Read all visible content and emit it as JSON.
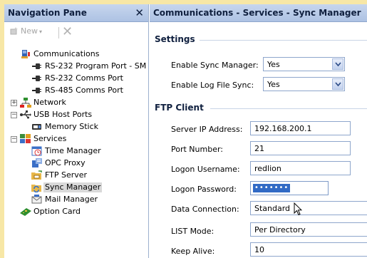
{
  "nav": {
    "title": "Navigation Pane",
    "new_label": "New",
    "tree": [
      {
        "label": "Communications",
        "icon": "communications-icon"
      },
      {
        "label": "RS-232 Program Port - SM",
        "icon": "serial-port-icon"
      },
      {
        "label": "RS-232 Comms Port",
        "icon": "serial-port-icon"
      },
      {
        "label": "RS-485 Comms Port",
        "icon": "serial-port-icon"
      },
      {
        "label": "Network",
        "icon": "network-icon"
      },
      {
        "label": "USB Host Ports",
        "icon": "usb-icon"
      },
      {
        "label": "Memory Stick",
        "icon": "memory-stick-icon"
      },
      {
        "label": "Services",
        "icon": "services-icon"
      },
      {
        "label": "Time Manager",
        "icon": "time-manager-icon"
      },
      {
        "label": "OPC Proxy",
        "icon": "opc-proxy-icon"
      },
      {
        "label": "FTP Server",
        "icon": "ftp-server-icon"
      },
      {
        "label": "Sync Manager",
        "icon": "sync-manager-icon"
      },
      {
        "label": "Mail Manager",
        "icon": "mail-manager-icon"
      },
      {
        "label": "Option Card",
        "icon": "option-card-icon"
      }
    ]
  },
  "main": {
    "title": "Communications - Services - Sync Manager",
    "settings": {
      "title": "Settings",
      "enable_sync_label": "Enable Sync Manager:",
      "enable_sync_value": "Yes",
      "enable_log_label": "Enable Log File Sync:",
      "enable_log_value": "Yes"
    },
    "ftp": {
      "title": "FTP Client",
      "server_ip_label": "Server IP Address:",
      "server_ip_value": "192.168.200.1",
      "port_label": "Port Number:",
      "port_value": "21",
      "username_label": "Logon Username:",
      "username_value": "redlion",
      "password_label": "Logon Password:",
      "password_value": "•••••••",
      "data_conn_label": "Data Connection:",
      "data_conn_value": "Standard",
      "list_mode_label": "LIST Mode:",
      "list_mode_value": "Per Directory",
      "keep_alive_label": "Keep Alive:",
      "keep_alive_value": "10"
    }
  },
  "colors": {
    "header": "#b9cbe8",
    "selection": "#316ac5",
    "outer_border": "#f7e7a6"
  }
}
